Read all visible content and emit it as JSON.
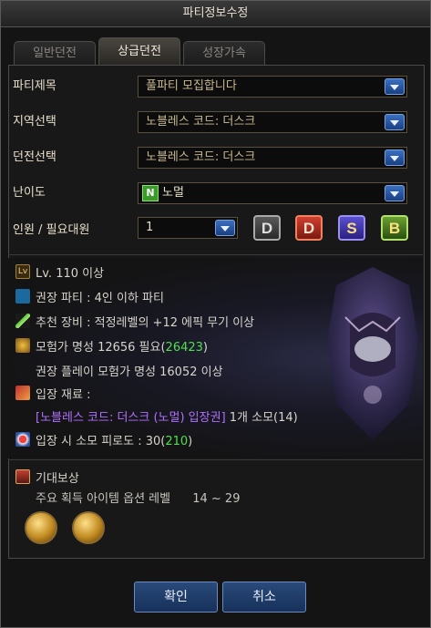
{
  "window": {
    "title": "파티정보수정"
  },
  "tabs": [
    {
      "label": "일반던전",
      "active": false
    },
    {
      "label": "상급던전",
      "active": true
    },
    {
      "label": "성장가속",
      "active": false
    }
  ],
  "form": {
    "party_title": {
      "label": "파티제목",
      "value": "풀파티 모집합니다"
    },
    "region": {
      "label": "지역선택",
      "value": "노블레스 코드: 더스크"
    },
    "dungeon": {
      "label": "던전선택",
      "value": "노블레스 코드: 더스크"
    },
    "difficulty": {
      "label": "난이도",
      "badge": "N",
      "value": "노멀"
    },
    "members": {
      "label": "인원 / 필요대원",
      "value": "1"
    },
    "role_buttons": [
      "D",
      "D",
      "S",
      "B"
    ]
  },
  "info": {
    "level": "Lv. 110 이상",
    "level_icon": "Lv",
    "party": "권장 파티 : 4인 이하 파티",
    "gear": "추천 장비 : 적정레벨의 +12 에픽 무기 이상",
    "fame_prefix": "모험가 명성 12656 필요(",
    "fame_value": "26423",
    "fame_suffix": ")",
    "recommend_fame": "권장 플레이 모험가 명성 16052 이상",
    "entry_label": "입장 재료 :",
    "entry_item": "[노블레스 코드: 더스크 (노멀) 입장권]",
    "entry_count": " 1개 소모(14)",
    "fatigue_prefix": "입장 시 소모 피로도 : 30(",
    "fatigue_value": "210",
    "fatigue_suffix": ")"
  },
  "reward": {
    "title": "기대보상",
    "line": "주요 획득 아이템 옵션 레벨",
    "range": "14 ~ 29"
  },
  "buttons": {
    "confirm": "확인",
    "cancel": "취소"
  },
  "colors": {
    "accent": "#4ee04e",
    "item": "#b070ff",
    "button": "#2a4a7a"
  }
}
